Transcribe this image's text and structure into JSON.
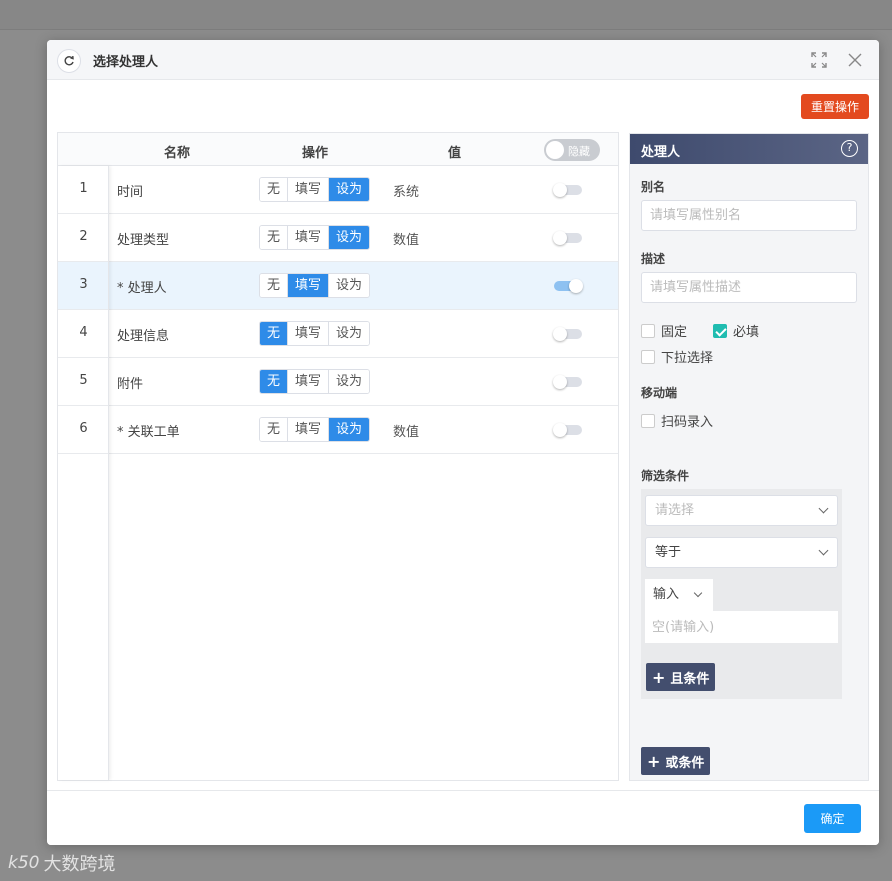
{
  "dialog": {
    "title": "选择处理人",
    "reset_label": "重置操作",
    "ok_label": "确定"
  },
  "table": {
    "headers": {
      "name": "名称",
      "op": "操作",
      "value": "值",
      "toggle": "隐藏"
    },
    "seg_labels": [
      "无",
      "填写",
      "设为"
    ],
    "rows": [
      {
        "num": "1",
        "name": "时间",
        "active": 2,
        "value": "系统",
        "on": false
      },
      {
        "num": "2",
        "name": "处理类型",
        "active": 2,
        "value": "数值",
        "on": false
      },
      {
        "num": "3",
        "name": "* 处理人",
        "active": 1,
        "value": "",
        "on": true
      },
      {
        "num": "4",
        "name": "处理信息",
        "active": 0,
        "value": "",
        "on": false
      },
      {
        "num": "5",
        "name": "附件",
        "active": 0,
        "value": "",
        "on": false
      },
      {
        "num": "6",
        "name": "* 关联工单",
        "active": 2,
        "value": "数值",
        "on": false
      }
    ]
  },
  "side": {
    "title": "处理人",
    "alias_label": "别名",
    "alias_placeholder": "请填写属性别名",
    "desc_label": "描述",
    "desc_placeholder": "请填写属性描述",
    "fixed_label": "固定",
    "required_label": "必填",
    "dropdown_label": "下拉选择",
    "mobile_label": "移动端",
    "scan_label": "扫码录入",
    "filter_label": "筛选条件",
    "select_placeholder": "请选择",
    "operator_value": "等于",
    "input_type": "输入",
    "input_placeholder": "空(请输入)",
    "and_label": "且条件",
    "or_label": "或条件"
  },
  "watermark": {
    "logo": "k50",
    "text": "大数跨境"
  }
}
